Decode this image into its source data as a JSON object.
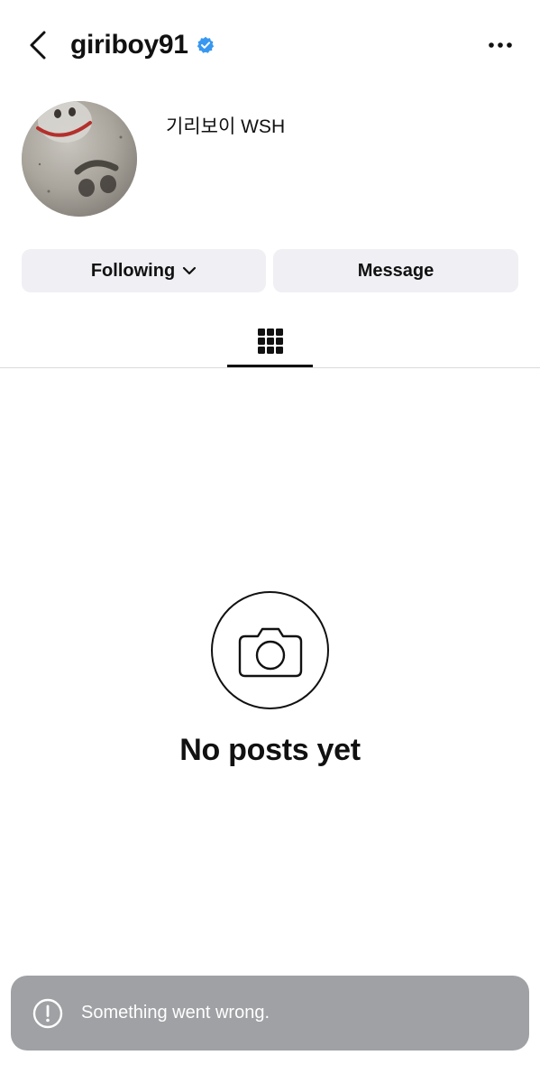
{
  "header": {
    "username": "giriboy91",
    "verified_icon": "verified-badge-icon",
    "back_icon": "chevron-left-icon",
    "more_icon": "more-horizontal-icon"
  },
  "profile": {
    "display_name": "기리보이 WSH",
    "avatar_icon": "profile-photo"
  },
  "actions": {
    "following_label": "Following",
    "message_label": "Message"
  },
  "tabs": {
    "active": "grid-icon"
  },
  "empty_state": {
    "icon": "camera-icon",
    "title": "No posts yet"
  },
  "toast": {
    "icon": "alert-circle-icon",
    "message": "Something went wrong."
  },
  "colors": {
    "verified": "#3897f0",
    "button_bg": "#efeff4",
    "toast_bg": "#9fa1a4"
  }
}
